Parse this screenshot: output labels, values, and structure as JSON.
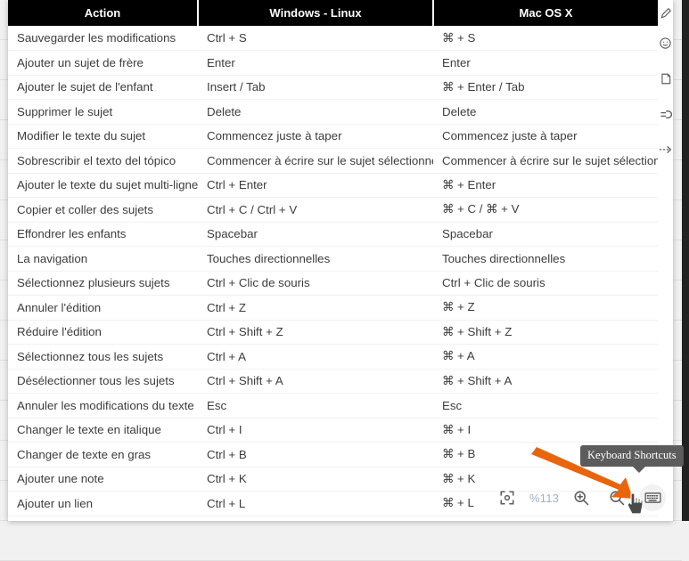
{
  "dialog": {
    "title": "Keyboard Shortcuts"
  },
  "table": {
    "columns": [
      "Action",
      "Windows - Linux",
      "Mac OS X"
    ],
    "rows": [
      [
        "Sauvegarder les modifications",
        "Ctrl + S",
        "⌘ + S"
      ],
      [
        "Ajouter un sujet de frère",
        "Enter",
        "Enter"
      ],
      [
        "Ajouter le sujet de l'enfant",
        "Insert / Tab",
        "⌘ + Enter / Tab"
      ],
      [
        "Supprimer le sujet",
        "Delete",
        "Delete"
      ],
      [
        "Modifier le texte du sujet",
        "Commencez juste à taper",
        "Commencez juste à taper"
      ],
      [
        "Sobrescribir el texto del tópico",
        "Commencer à écrire sur le sujet sélectionné",
        "Commencer à écrire sur le sujet sélectionné"
      ],
      [
        "Ajouter le texte du sujet multi-ligne",
        "Ctrl + Enter",
        "⌘ + Enter"
      ],
      [
        "Copier et coller des sujets",
        "Ctrl + C / Ctrl + V",
        "⌘ + C / ⌘ + V"
      ],
      [
        "Effondrer les enfants",
        "Spacebar",
        "Spacebar"
      ],
      [
        "La navigation",
        "Touches directionnelles",
        "Touches directionnelles"
      ],
      [
        "Sélectionnez plusieurs sujets",
        "Ctrl + Clic de souris",
        "Ctrl + Clic de souris"
      ],
      [
        "Annuler l'édition",
        "Ctrl + Z",
        "⌘ + Z"
      ],
      [
        "Réduire l'édition",
        "Ctrl + Shift + Z",
        "⌘ + Shift + Z"
      ],
      [
        "Sélectionnez tous les sujets",
        "Ctrl + A",
        "⌘ + A"
      ],
      [
        "Désélectionner tous les sujets",
        "Ctrl + Shift + A",
        "⌘ + Shift + A"
      ],
      [
        "Annuler les modifications du texte",
        "Esc",
        "Esc"
      ],
      [
        "Changer le texte en italique",
        "Ctrl + I",
        "⌘ + I"
      ],
      [
        "Changer de texte en gras",
        "Ctrl + B",
        "⌘ + B"
      ],
      [
        "Ajouter une note",
        "Ctrl + K",
        "⌘ + K"
      ],
      [
        "Ajouter un lien",
        "Ctrl + L",
        "⌘ + L"
      ]
    ]
  },
  "icon_rail": {
    "items": [
      {
        "name": "pencil-icon"
      },
      {
        "name": "smiley-icon"
      },
      {
        "name": "note-icon"
      },
      {
        "name": "link-icon"
      },
      {
        "name": "more-arrow-icon"
      }
    ]
  },
  "toolbar": {
    "fit_label": "fit-to-screen-icon",
    "zoom_level": "%113",
    "zoom_in_label": "zoom-in-icon",
    "zoom_out_label": "zoom-out-icon",
    "keyboard_label": "keyboard-icon"
  },
  "tooltip": {
    "text": "Keyboard Shortcuts"
  },
  "colors": {
    "header_bg": "#000000",
    "accent_orange": "#E8650D",
    "tooltip_bg": "#5c5c5c",
    "zoom_level_color": "#9fb1c4",
    "background": "#f1f1f1"
  }
}
